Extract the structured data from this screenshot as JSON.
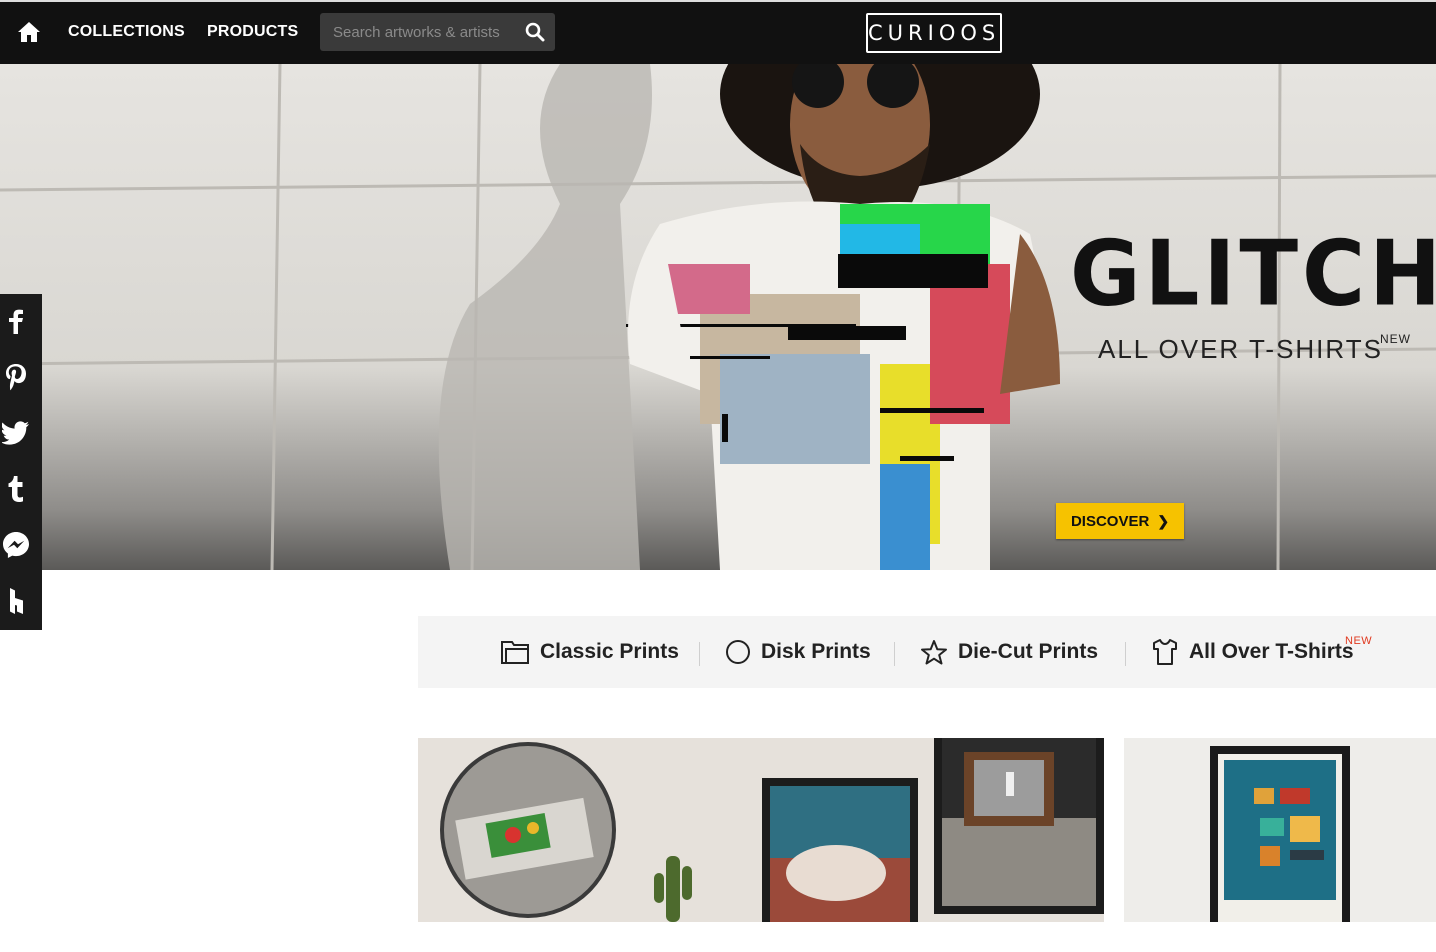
{
  "nav": {
    "collections_label": "COLLECTIONS",
    "products_label": "PRODUCTS",
    "search_placeholder": "Search artworks & artists",
    "logo_text": "CURIOOS"
  },
  "hero": {
    "title": "GLITCH",
    "subtitle": "ALL OVER T-SHIRTS",
    "badge": "NEW",
    "cta_label": "DISCOVER"
  },
  "social": {
    "items": [
      "facebook",
      "pinterest",
      "twitter",
      "tumblr",
      "messenger",
      "houzz"
    ]
  },
  "products": {
    "tabs": [
      {
        "label": "Classic Prints",
        "icon": "frame-icon"
      },
      {
        "label": "Disk Prints",
        "icon": "circle-icon"
      },
      {
        "label": "Die-Cut Prints",
        "icon": "star-icon"
      },
      {
        "label": "All Over T-Shirts",
        "icon": "tshirt-icon"
      }
    ],
    "new_badge": "NEW"
  },
  "colors": {
    "topbar": "#111111",
    "accent_yellow": "#f6c200",
    "new_red": "#e0391f"
  }
}
